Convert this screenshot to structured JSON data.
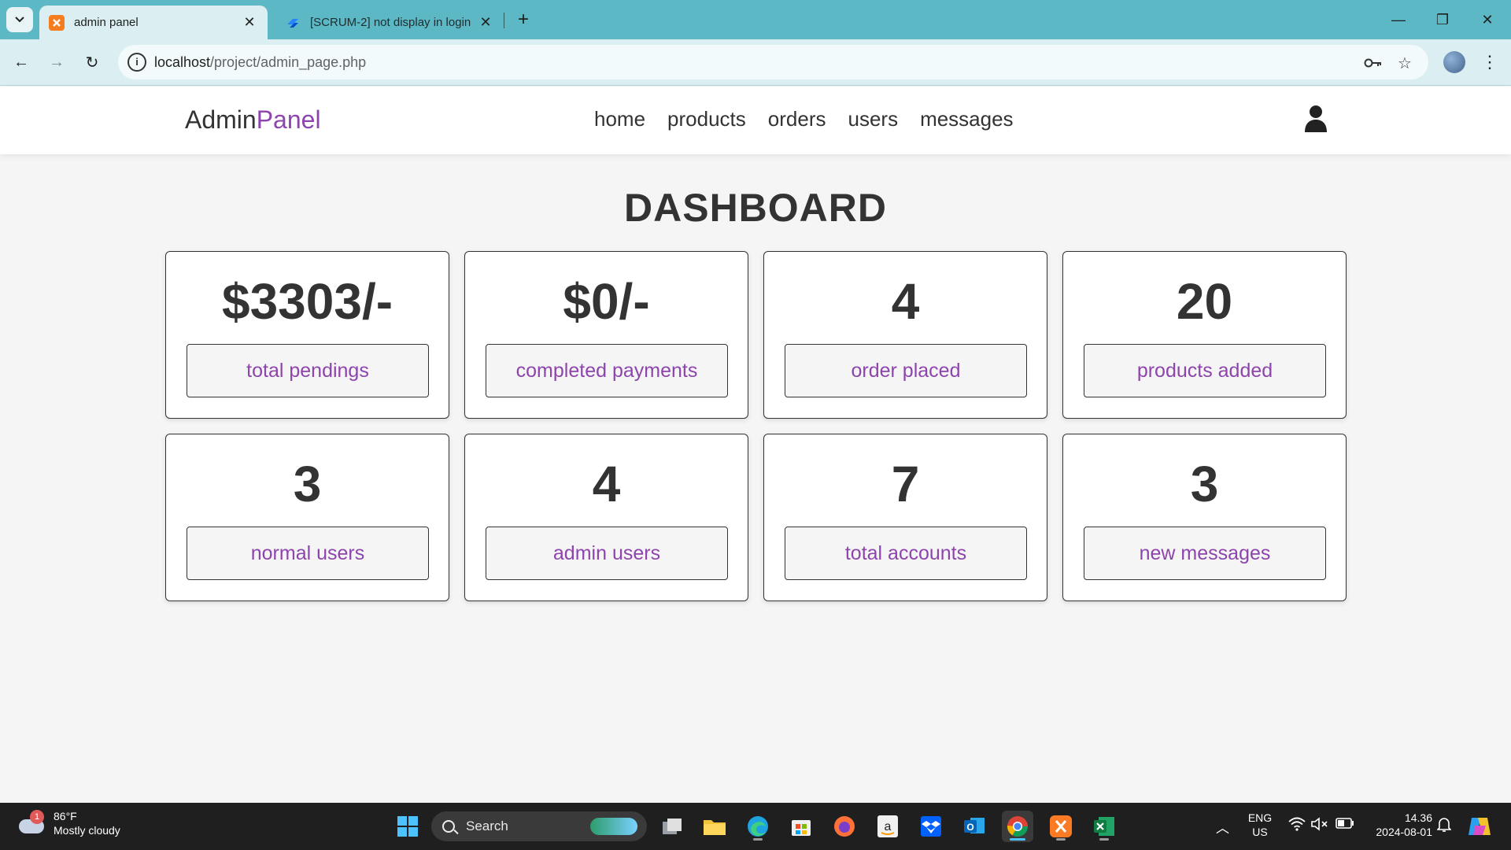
{
  "browser": {
    "tabs": [
      {
        "title": "admin panel",
        "active": true,
        "favicon": "xampp-icon"
      },
      {
        "title": "[SCRUM-2] not display in login",
        "active": false,
        "favicon": "jira-icon"
      }
    ],
    "address": {
      "host": "localhost",
      "path": "/project/admin_page.php"
    }
  },
  "header": {
    "logo_main": "Admin",
    "logo_accent": "Panel",
    "nav": [
      "home",
      "products",
      "orders",
      "users",
      "messages"
    ]
  },
  "dashboard": {
    "title": "DASHBOARD",
    "cards": [
      {
        "value": "$3303/-",
        "label": "total pendings"
      },
      {
        "value": "$0/-",
        "label": "completed payments"
      },
      {
        "value": "4",
        "label": "order placed"
      },
      {
        "value": "20",
        "label": "products added"
      },
      {
        "value": "3",
        "label": "normal users"
      },
      {
        "value": "4",
        "label": "admin users"
      },
      {
        "value": "7",
        "label": "total accounts"
      },
      {
        "value": "3",
        "label": "new messages"
      }
    ]
  },
  "taskbar": {
    "weather": {
      "badge": "1",
      "temp": "86°F",
      "condition": "Mostly cloudy"
    },
    "search_label": "Search",
    "language": {
      "line1": "ENG",
      "line2": "US"
    },
    "clock": {
      "time": "14.36",
      "date": "2024-08-01"
    }
  },
  "colors": {
    "accent": "#8e44ad",
    "text": "#333333",
    "tabbar": "#5bb8c4"
  }
}
